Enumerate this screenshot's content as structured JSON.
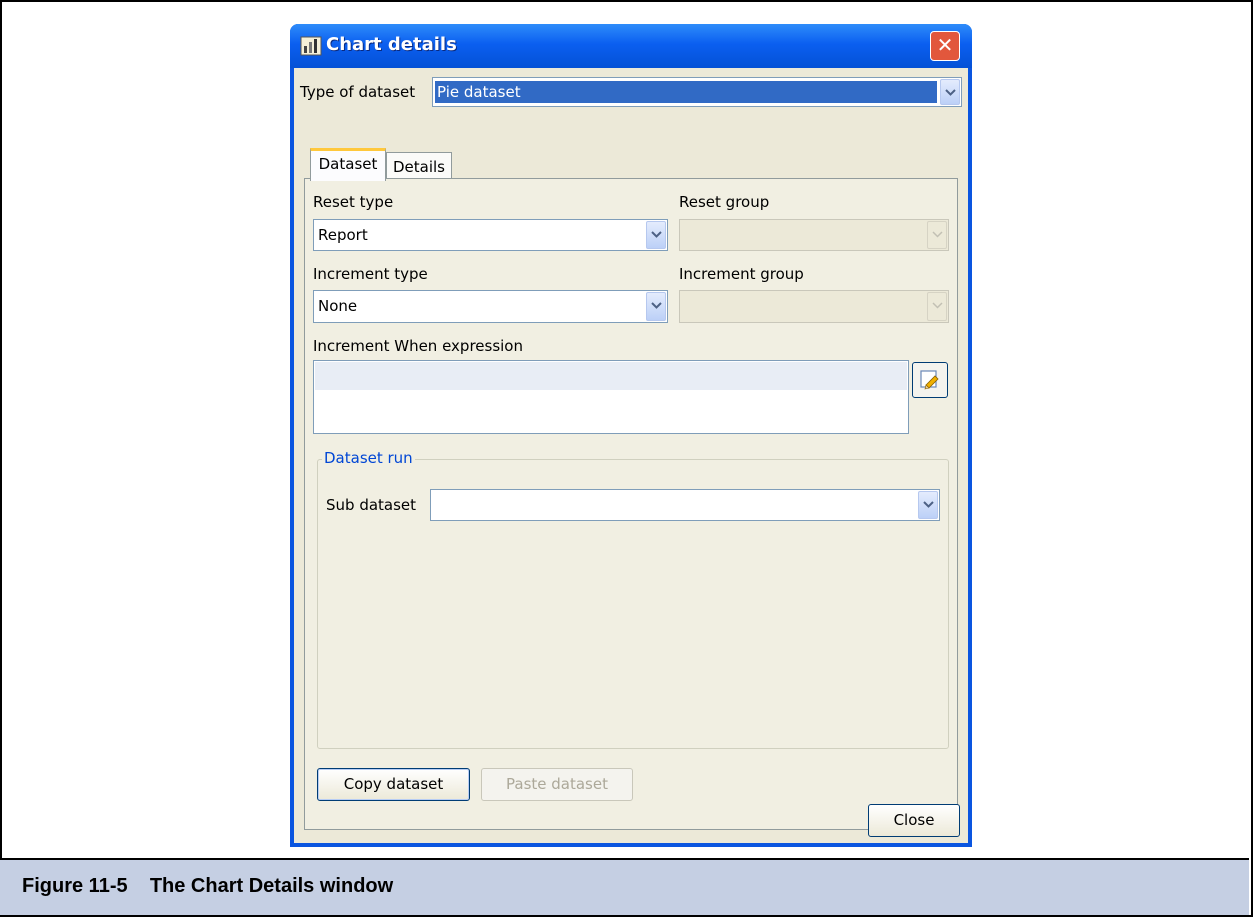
{
  "window": {
    "title": "Chart details",
    "close_glyph": "✕"
  },
  "dataset_type": {
    "label": "Type of dataset",
    "selected": "Pie dataset"
  },
  "tabs": [
    {
      "label": "Dataset",
      "active": true
    },
    {
      "label": "Details",
      "active": false
    }
  ],
  "reset": {
    "type_label": "Reset type",
    "type_value": "Report",
    "group_label": "Reset group",
    "group_value": ""
  },
  "increment": {
    "type_label": "Increment type",
    "type_value": "None",
    "group_label": "Increment group",
    "group_value": "",
    "when_label": "Increment When expression",
    "when_value": ""
  },
  "dataset_run": {
    "title": "Dataset run",
    "sub_dataset_label": "Sub dataset",
    "sub_dataset_value": ""
  },
  "buttons": {
    "copy": "Copy dataset",
    "paste": "Paste dataset",
    "close": "Close"
  },
  "figure": {
    "caption": "Figure 11-5    The Chart Details window"
  },
  "colors": {
    "title_bar": "#0b5ff0",
    "dialog_bg": "#ece9d8",
    "selection": "#316ac5",
    "caption_band": "#c5cfe3",
    "group_title": "#0046d5"
  }
}
